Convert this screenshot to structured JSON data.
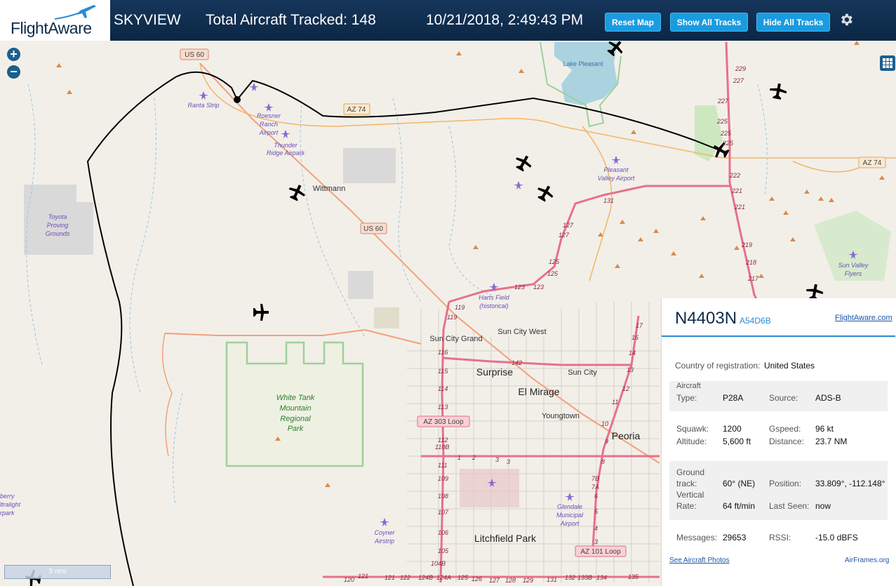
{
  "header": {
    "brand": "FlightAware",
    "app_name": "SKYVIEW",
    "aircraft_tracked": "Total Aircraft Tracked: 148",
    "datetime": "10/21/2018, 2:49:43 PM",
    "buttons": {
      "reset": "Reset Map",
      "show_tracks": "Show All Tracks",
      "hide_tracks": "Hide All Tracks"
    }
  },
  "map": {
    "zoom_in": "+",
    "zoom_out": "−",
    "scale": "5 nmi",
    "labels": {
      "ranta": "Ranta Strip",
      "roesner1": "Roesner",
      "roesner2": "Ranch",
      "roesner3": "Airport",
      "thunder1": "Thunder",
      "thunder2": "Ridge Airpark",
      "wittmann": "Wittmann",
      "toyota1": "Toyota",
      "toyota2": "Proving",
      "toyota3": "Grounds",
      "lake": "Lake Pleasant",
      "pleasant1": "Pleasant",
      "pleasant2": "Valley Airport",
      "harts1": "Harts Field",
      "harts2": "(historical)",
      "suncitywest": "Sun City West",
      "suncitygrand": "Sun City Grand",
      "surprise": "Surprise",
      "suncity": "Sun City",
      "elmirage": "El Mirage",
      "youngtown": "Youngtown",
      "peoria": "Peoria",
      "whitetank1": "White Tank",
      "whitetank2": "Mountain",
      "whitetank3": "Regional",
      "whitetank4": "Park",
      "glendale1": "Glendale",
      "glendale2": "Municipal",
      "glendale3": "Airport",
      "coyner1": "Coyner",
      "coyner2": "Airstrip",
      "litchfield": "Litchfield Park",
      "sunvalley1": "Sun Valley",
      "sunvalley2": "Flyers",
      "westedge1": "berry",
      "westedge2": "ltralight",
      "westedge3": "rpark"
    },
    "shields": {
      "us60a": "US 60",
      "us60b": "US 60",
      "az74a": "AZ 74",
      "az74b": "AZ 74",
      "az303": "AZ 303 Loop",
      "az101": "AZ 101 Loop"
    },
    "exits": {
      "e229": "229",
      "e227": "227",
      "e227b": "227",
      "e225": "225",
      "e225b": "225",
      "e222": "222",
      "e221": "221",
      "e221b": "221",
      "e219": "219",
      "e218": "218",
      "e217": "217",
      "e131": "131",
      "e127": "127",
      "e127b": "127",
      "e125": "125",
      "e125b": "125",
      "e123": "123",
      "e123b": "123",
      "e119": "119",
      "e119b": "119",
      "e116": "116",
      "e115": "115",
      "e114": "114",
      "e113": "113",
      "e112": "112",
      "e110b": "110B",
      "e111": "111",
      "e109": "109",
      "e108": "108",
      "e107": "107",
      "e106": "106",
      "e105": "105",
      "e104b": "104B",
      "e142": "142",
      "e17": "17",
      "e16": "16",
      "e14": "14",
      "e13": "13",
      "e12": "12",
      "e11": "11",
      "e10": "10",
      "e9": "9",
      "e8": "8",
      "e7b": "7B",
      "e7a": "7A",
      "e6": "6",
      "e5": "5",
      "e4": "4",
      "e3": "3",
      "e1": "1",
      "e2": "2",
      "e3b": "3",
      "e3c": "3",
      "b120": "120",
      "b121": "121",
      "b122": "122",
      "b124b": "124B",
      "b124a": "124A",
      "b125": "125",
      "b126": "126",
      "b127": "127",
      "b128": "128",
      "b129": "129",
      "b131": "131",
      "b132": "132",
      "b133b": "133B",
      "b134": "134",
      "b135": "135"
    }
  },
  "panel": {
    "callsign": "N4403N",
    "hex": "A54D6B",
    "link": "FlightAware.com",
    "country_label": "Country of registration:",
    "country_value": "United States",
    "type_label1": "Aircraft",
    "type_label2": "Type:",
    "type_value": "P28A",
    "source_label": "Source:",
    "source_value": "ADS-B",
    "squawk_label": "Squawk:",
    "squawk_value": "1200",
    "gspeed_label": "Gspeed:",
    "gspeed_value": "96 kt",
    "altitude_label": "Altitude:",
    "altitude_value": "5,600 ft",
    "distance_label": "Distance:",
    "distance_value": "23.7 NM",
    "track_label1": "Ground",
    "track_label2": "track:",
    "track_value": "60° (NE)",
    "position_label": "Position:",
    "position_value": "33.809°, -112.148°",
    "vrate_label1": "Vertical",
    "vrate_label2": "Rate:",
    "vrate_value": "64 ft/min",
    "lastseen_label": "Last Seen:",
    "lastseen_value": "now",
    "messages_label": "Messages:",
    "messages_value": "29653",
    "rssi_label": "RSSI:",
    "rssi_value": "-15.0 dBFS",
    "photos_link": "See Aircraft Photos",
    "airframes_link": "AirFrames.org"
  },
  "colors": {
    "header_bg": "#0d2b4c",
    "button": "#1a9be0",
    "map_bg": "#f2efe9",
    "highway": "#e8708a",
    "road": "#f5b565",
    "track": "#000000",
    "water": "#aad3df",
    "park_border": "#9fcf9c"
  }
}
